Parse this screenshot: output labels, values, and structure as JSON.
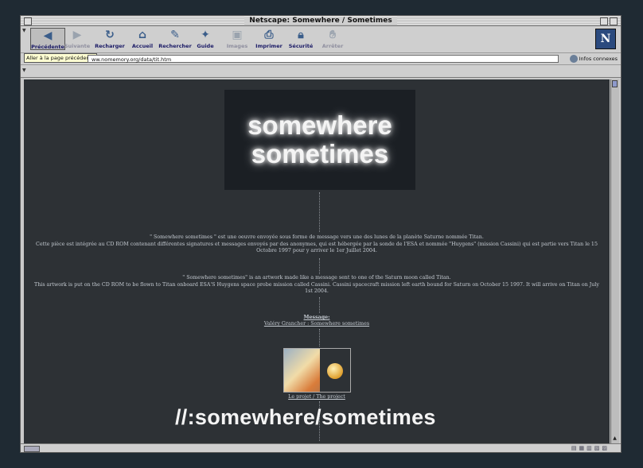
{
  "window": {
    "title": "Netscape: Somewhere / Sometimes"
  },
  "toolbar": {
    "buttons": [
      {
        "label": "Précédente",
        "icon": "back-arrow-icon"
      },
      {
        "label": "Suivante",
        "icon": "forward-arrow-icon"
      },
      {
        "label": "Recharger",
        "icon": "reload-icon"
      },
      {
        "label": "Accueil",
        "icon": "home-icon"
      },
      {
        "label": "Rechercher",
        "icon": "search-icon"
      },
      {
        "label": "Guide",
        "icon": "guide-icon"
      },
      {
        "label": "Images",
        "icon": "images-icon"
      },
      {
        "label": "Imprimer",
        "icon": "print-icon"
      },
      {
        "label": "Sécurité",
        "icon": "lock-icon"
      },
      {
        "label": "Arrêter",
        "icon": "stop-icon"
      }
    ],
    "logo_letter": "N"
  },
  "location": {
    "url": "ww.nomemory.org/data/tit.htm",
    "tooltip": "Aller à la page précédente",
    "related_label": "Infos connexes"
  },
  "content": {
    "banner_line1": "somewhere",
    "banner_line2": "sometimes",
    "fr_line1": "\" Somewhere sometimes \" est une oeuvre envoyée sous forme de message vers une des lunes de la planète Saturne nommée Titan.",
    "fr_line2": "Cette pièce est intégrée au CD ROM contenant différentes signatures et messages envoyés par des anonymes, qui est hébergée par la sonde de l'ESA et nommée \"Huygens\" (mission Cassini) qui est partie vers Titan le 15",
    "fr_line3": "Octobre 1997 pour y arriver le 1er Juillet 2004.",
    "en_line1": "\" Somewhere sometimes\" is an artwork made like a message sent to one of the Saturn moon called Titan.",
    "en_line2": "This artwork is put on the CD ROM to be flown to Titan onboard ESA'S Huygens space probe mission called Cassini. Cassini spacecraft mission left earth bound for Saturn on October 15 1997. It will arrive on Titan on July",
    "en_line3": "1st 2004.",
    "message_title": "Message:",
    "message_link": "Valéry Grancher : Somewhere sometimes",
    "project_link": "Le projet / The project",
    "tagline": "//:somewhere/sometimes"
  },
  "colors": {
    "page_background": "#2d3135",
    "text": "#c5cbd2",
    "chrome": "#cfcfcf"
  }
}
